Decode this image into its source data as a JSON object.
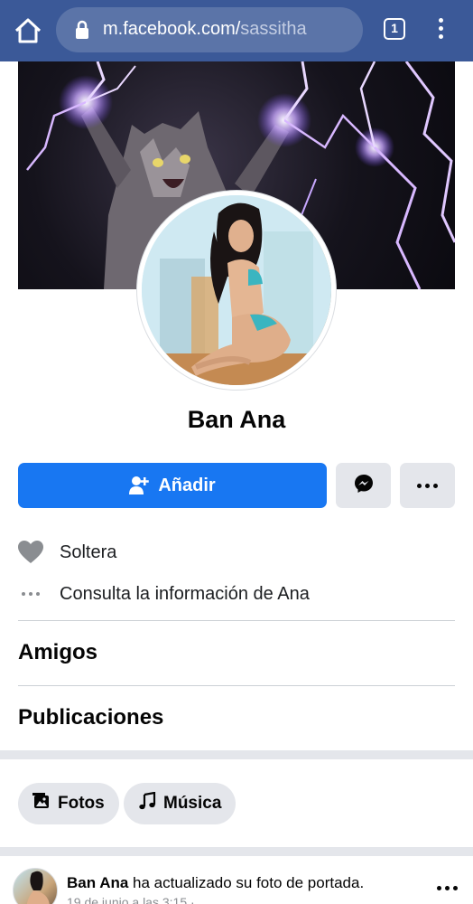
{
  "browser": {
    "url_host": "m.facebook.com/",
    "url_path": "sassitha",
    "tab_count": "1",
    "icons": [
      "home-icon",
      "lock-icon",
      "tabs-icon",
      "overflow-menu-icon"
    ]
  },
  "profile": {
    "name": "Ban Ana",
    "add_label": "Añadir",
    "info": [
      {
        "icon": "heart-icon",
        "text": "Soltera"
      },
      {
        "icon": "more-dots-icon",
        "text": "Consulta la información de Ana"
      }
    ]
  },
  "sections": {
    "friends": "Amigos",
    "posts": "Publicaciones"
  },
  "chips": {
    "photos": "Fotos",
    "music": "Música"
  },
  "post": {
    "author": "Ban Ana",
    "action": " ha actualizado su foto de portada.",
    "time": "19 de junio a las 3:15 · "
  },
  "colors": {
    "browser_bar": "#3b5998",
    "primary": "#1877f2",
    "button_gray": "#e4e6eb",
    "text": "#050505",
    "secondary_text": "#8a8d91"
  }
}
